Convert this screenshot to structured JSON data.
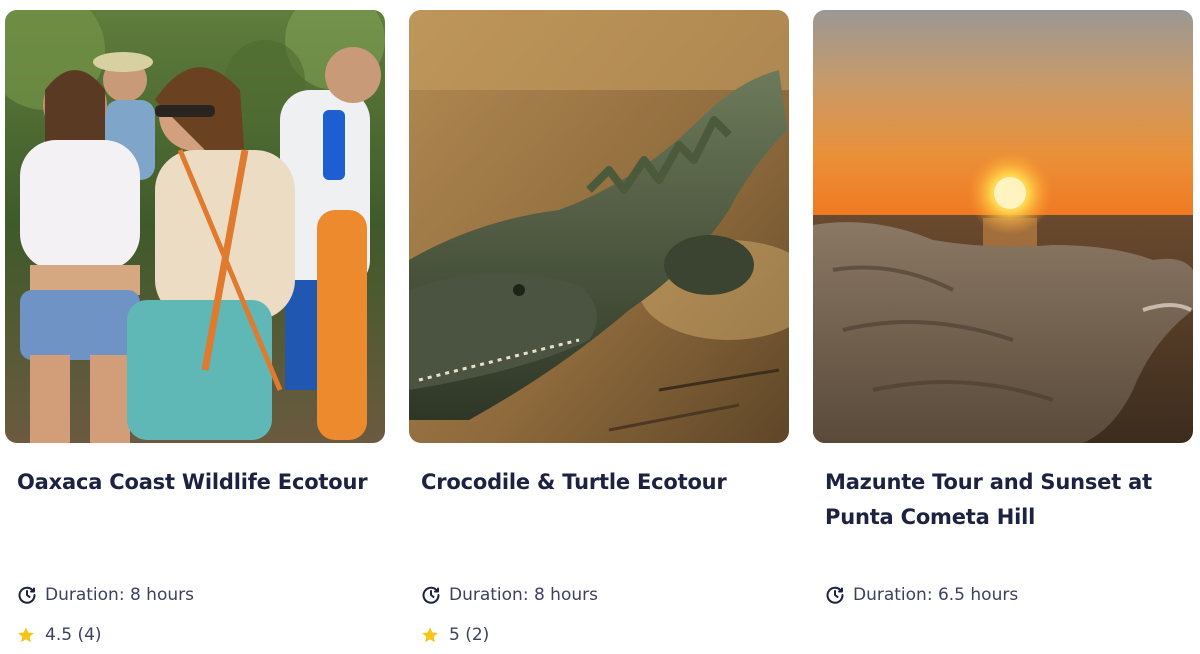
{
  "cards": [
    {
      "title": "Oaxaca Coast Wildlife Ecotour",
      "duration": "Duration: 8 hours",
      "rating": "4.5 (4)",
      "photo_icon": "tour-group-photo"
    },
    {
      "title": "Crocodile & Turtle Ecotour",
      "duration": "Duration: 8 hours",
      "rating": "5 (2)",
      "photo_icon": "crocodile-photo"
    },
    {
      "title": "Mazunte Tour and Sunset at Punta Cometa Hill",
      "duration": "Duration: 6.5 hours",
      "photo_icon": "sunset-photo"
    }
  ],
  "icons": {
    "duration": "clock-icon",
    "rating": "star-icon"
  },
  "colors": {
    "title": "#1c2240",
    "meta_text": "#3c4160",
    "star": "#f5c518"
  }
}
